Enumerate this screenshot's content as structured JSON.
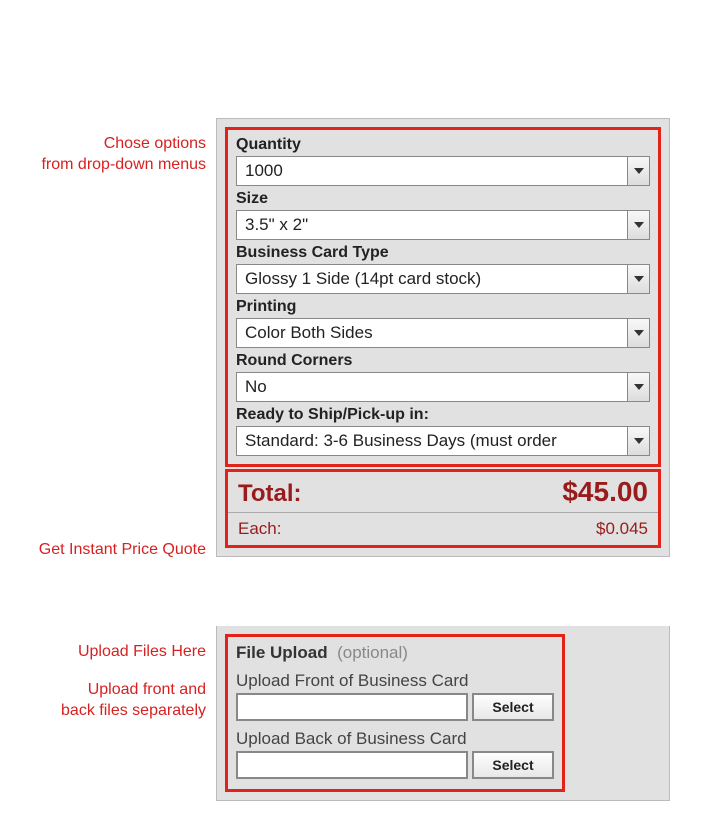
{
  "annotations": {
    "options1": "Chose options",
    "options2": "from drop-down menus",
    "price": "Get Instant Price Quote",
    "upload1": "Upload Files Here",
    "upload2": "Upload front and",
    "upload3": "back files separately"
  },
  "fields": {
    "quantity": {
      "label": "Quantity",
      "value": "1000"
    },
    "size": {
      "label": "Size",
      "value": "3.5\" x 2\""
    },
    "cardType": {
      "label": "Business Card Type",
      "value": "Glossy 1 Side (14pt card stock)"
    },
    "printing": {
      "label": "Printing",
      "value": "Color Both Sides"
    },
    "roundCorners": {
      "label": "Round Corners",
      "value": "No"
    },
    "shipping": {
      "label": "Ready to Ship/Pick-up in:",
      "value": "Standard: 3-6 Business Days (must order"
    }
  },
  "price": {
    "totalLabel": "Total:",
    "totalValue": "$45.00",
    "eachLabel": "Each:",
    "eachValue": "$0.045"
  },
  "upload": {
    "titleBold": "File Upload",
    "titleOptional": "(optional)",
    "frontLabel": "Upload Front of Business Card",
    "backLabel": "Upload Back of Business Card",
    "selectBtn": "Select"
  }
}
